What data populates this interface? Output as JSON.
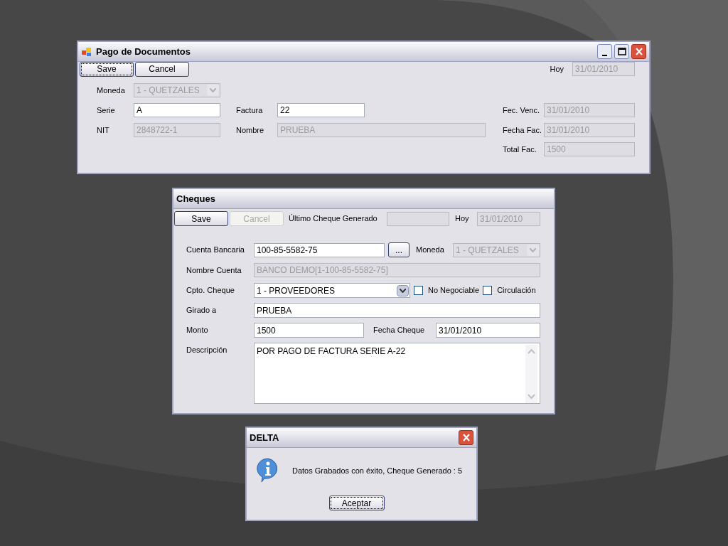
{
  "pago_window": {
    "title": "Pago de Documentos",
    "toolbar": [
      {
        "label": "Save",
        "disabled": false,
        "focused": true
      },
      {
        "label": "Cancel",
        "disabled": false,
        "focused": false
      }
    ],
    "hoy": {
      "label": "Hoy",
      "value": "31/01/2010",
      "disabled": true
    },
    "moneda": {
      "label": "Moneda",
      "value": "1 - QUETZALES",
      "disabled": true
    },
    "serie": {
      "label": "Serie",
      "value": "A",
      "disabled": false
    },
    "factura": {
      "label": "Factura",
      "value": "22",
      "disabled": false
    },
    "fec_venc": {
      "label": "Fec. Venc.",
      "value": "31/01/2010",
      "disabled": true
    },
    "nit": {
      "label": "NIT",
      "value": "2848722-1",
      "disabled": true
    },
    "nombre": {
      "label": "Nombre",
      "value": "PRUEBA",
      "disabled": true
    },
    "fecha_fac": {
      "label": "Fecha Fac.",
      "value": "31/01/2010",
      "disabled": true
    },
    "total_fac": {
      "label": "Total Fac.",
      "value": "1500",
      "disabled": true
    }
  },
  "cheques_window": {
    "title": "Cheques",
    "toolbar": [
      {
        "label": "Save",
        "disabled": false,
        "focused": false
      },
      {
        "label": "Cancel",
        "disabled": true,
        "focused": false
      }
    ],
    "ultimo": {
      "label": "Último Cheque Generado",
      "disabled": true
    },
    "hoy": {
      "label": "Hoy",
      "value": "31/01/2010",
      "disabled": true
    },
    "cuenta": {
      "label": "Cuenta Bancaria",
      "value": "100-85-5582-75",
      "disabled": false
    },
    "browse_button": {
      "label": "...",
      "disabled": false,
      "focused": false
    },
    "moneda": {
      "label": "Moneda",
      "value": "1 - QUETZALES",
      "disabled": true
    },
    "nombre_cuenta": {
      "label": "Nombre Cuenta",
      "value": "BANCO DEMO[1-100-85-5582-75]",
      "disabled": true
    },
    "cpto": {
      "label": "Cpto. Cheque",
      "value": "1 - PROVEEDORES",
      "disabled": false
    },
    "checkboxes": [
      {
        "label": "No Negociable",
        "checked": false
      },
      {
        "label": "Circulación",
        "checked": false
      }
    ],
    "girado": {
      "label": "Girado a",
      "value": "PRUEBA",
      "disabled": false
    },
    "monto": {
      "label": "Monto",
      "value": "1500",
      "disabled": false
    },
    "fecha_cheque": {
      "label": "Fecha Cheque",
      "value": "31/01/2010",
      "disabled": false
    },
    "descripcion": {
      "label": "Descripción",
      "value": "POR PAGO DE FACTURA SERIE A-22",
      "disabled": false
    }
  },
  "dialog": {
    "title": "DELTA",
    "message": "Datos Grabados con éxito, Cheque Generado : 5",
    "button": {
      "label": "Aceptar",
      "disabled": false,
      "focused": true
    }
  }
}
